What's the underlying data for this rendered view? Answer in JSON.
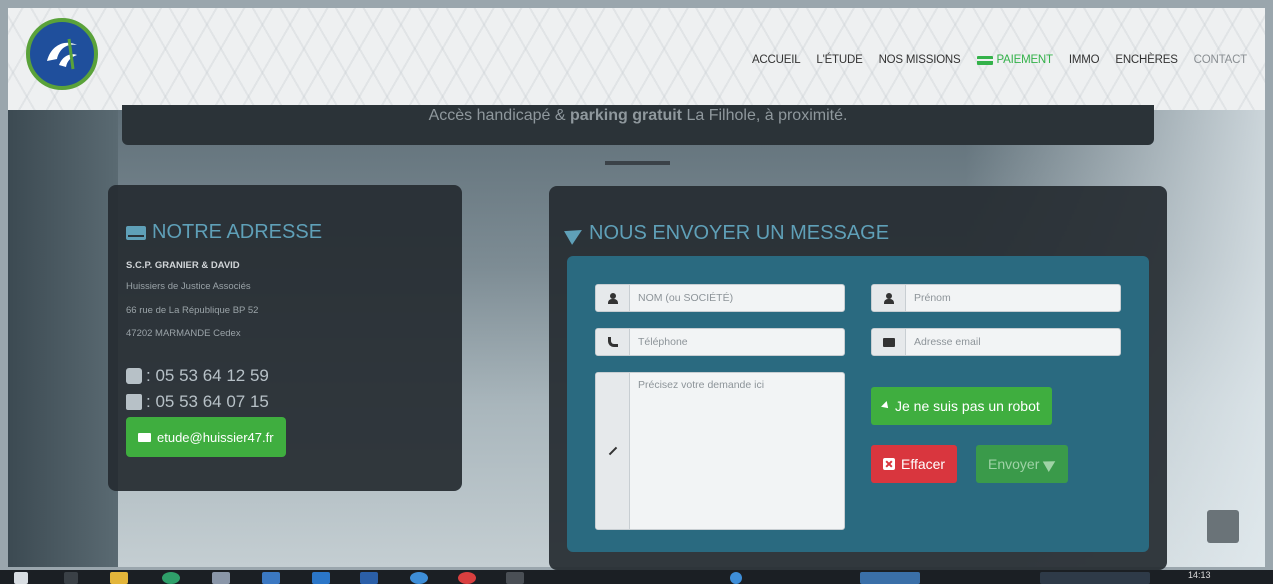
{
  "nav": {
    "items": [
      {
        "label": "ACCUEIL"
      },
      {
        "label": "L'ÉTUDE"
      },
      {
        "label": "NOS MISSIONS"
      },
      {
        "label": "PAIEMENT"
      },
      {
        "label": "IMMO"
      },
      {
        "label": "ENCHÈRES"
      },
      {
        "label": "CONTACT"
      }
    ]
  },
  "banner": {
    "text_before": "Accès handicapé & ",
    "text_bold": "parking gratuit",
    "text_after": " La Filhole, à proximité."
  },
  "address": {
    "title": "NOTRE ADRESSE",
    "company": "S.C.P. GRANIER & DAVID",
    "line1": "Huissiers de Justice Associés",
    "line2": "66 rue de La République BP 52",
    "line3": "47202 MARMANDE Cedex",
    "phone": ": 05 53 64 12 59",
    "fax": ": 05 53 64 07 15",
    "email": "etude@huissier47.fr"
  },
  "message": {
    "title": "NOUS ENVOYER UN MESSAGE",
    "name_placeholder": "NOM (ou SOCIÉTÉ)",
    "firstname_placeholder": "Prénom",
    "phone_placeholder": "Téléphone",
    "email_placeholder": "Adresse email",
    "request_placeholder": "Précisez votre demande ici",
    "robot_label": "Je ne suis pas un robot",
    "clear_label": "Effacer",
    "send_label": "Envoyer"
  },
  "taskbar": {
    "clock": "14:13"
  },
  "colors": {
    "accent": "#5fa0b8",
    "green": "#3fae3f",
    "red": "#d9363e",
    "panel": "#262c32",
    "form": "#2a6a80"
  }
}
